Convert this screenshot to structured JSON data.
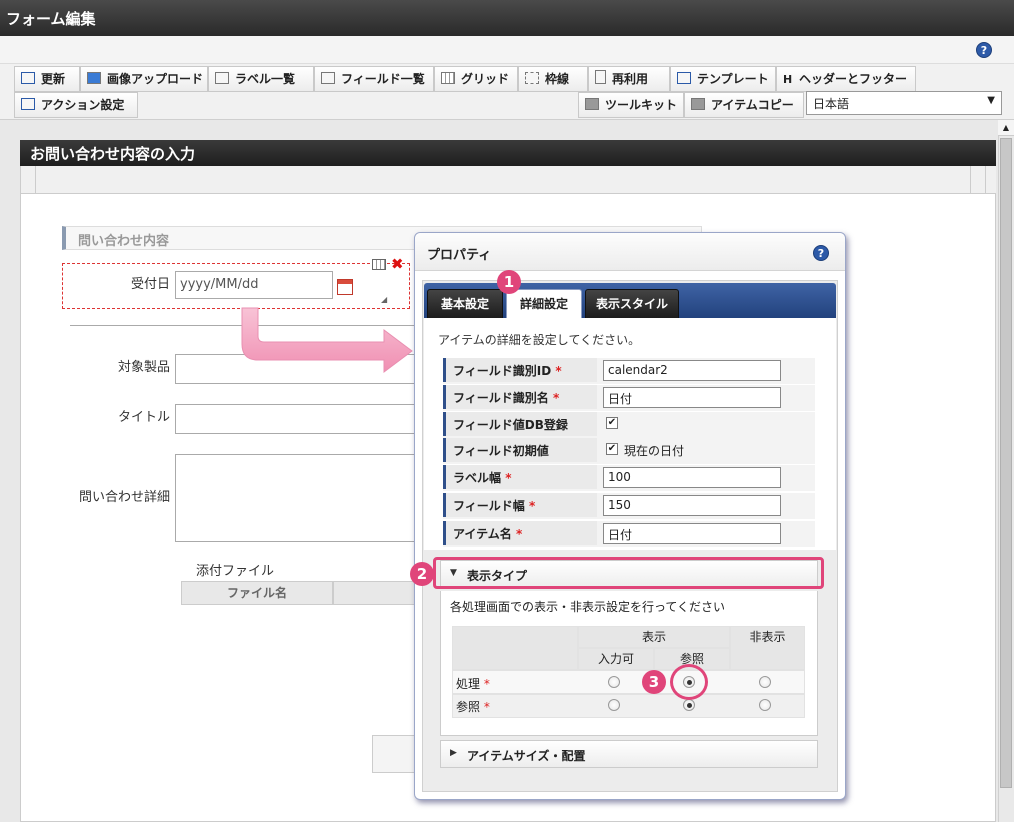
{
  "window": {
    "title": "フォーム編集"
  },
  "toolbar": {
    "row1": [
      "更新",
      "画像アップロード",
      "ラベル一覧",
      "フィールド一覧",
      "グリッド",
      "枠線",
      "再利用",
      "テンプレート",
      "ヘッダーとフッター"
    ],
    "row2_left": [
      "アクション設定"
    ],
    "row2_right": [
      "ツールキット",
      "アイテムコピー"
    ],
    "header_icon_glyph": "H",
    "language": {
      "selected": "日本語"
    }
  },
  "help_glyph": "?",
  "form": {
    "section_title": "お問い合わせ内容の入力",
    "group_title": "問い合わせ内容",
    "fields": {
      "date_label": "受付日",
      "date_placeholder": "yyyy/MM/dd",
      "product_label": "対象製品",
      "title_label": "タイトル",
      "detail_label": "問い合わせ詳細",
      "attach_label": "添付ファイル",
      "file_col": "ファイル名"
    }
  },
  "panel": {
    "title": "プロパティ",
    "tabs": [
      "基本設定",
      "詳細設定",
      "表示スタイル"
    ],
    "description": "アイテムの詳細を設定してください。",
    "rows": [
      {
        "label": "フィールド識別ID",
        "required": true,
        "value": "calendar2"
      },
      {
        "label": "フィールド識別名",
        "required": true,
        "value": "日付"
      },
      {
        "label": "フィールド値DB登録",
        "required": false,
        "checkbox": "✔"
      },
      {
        "label": "フィールド初期値",
        "required": false,
        "checkbox": "✔",
        "check_label": "現在の日付"
      },
      {
        "label": "ラベル幅",
        "required": true,
        "value": "100"
      },
      {
        "label": "フィールド幅",
        "required": true,
        "value": "150"
      },
      {
        "label": "アイテム名",
        "required": true,
        "value": "日付"
      }
    ],
    "required_mark": "*",
    "display_type": {
      "title": "表示タイプ",
      "description": "各処理画面での表示・非表示設定を行ってください",
      "col_display": "表示",
      "col_input": "入力可",
      "col_ref": "参照",
      "col_hidden": "非表示",
      "rows": [
        {
          "label": "処理",
          "selected": "ref"
        },
        {
          "label": "参照",
          "selected": "ref"
        }
      ]
    },
    "size_section": {
      "title": "アイテムサイズ・配置"
    }
  },
  "callouts": [
    "1",
    "2",
    "3"
  ],
  "colors": {
    "accent_pink": "#e0457a",
    "tab_blue": "#2f4f8a",
    "title_dark": "#2a2a2a"
  }
}
